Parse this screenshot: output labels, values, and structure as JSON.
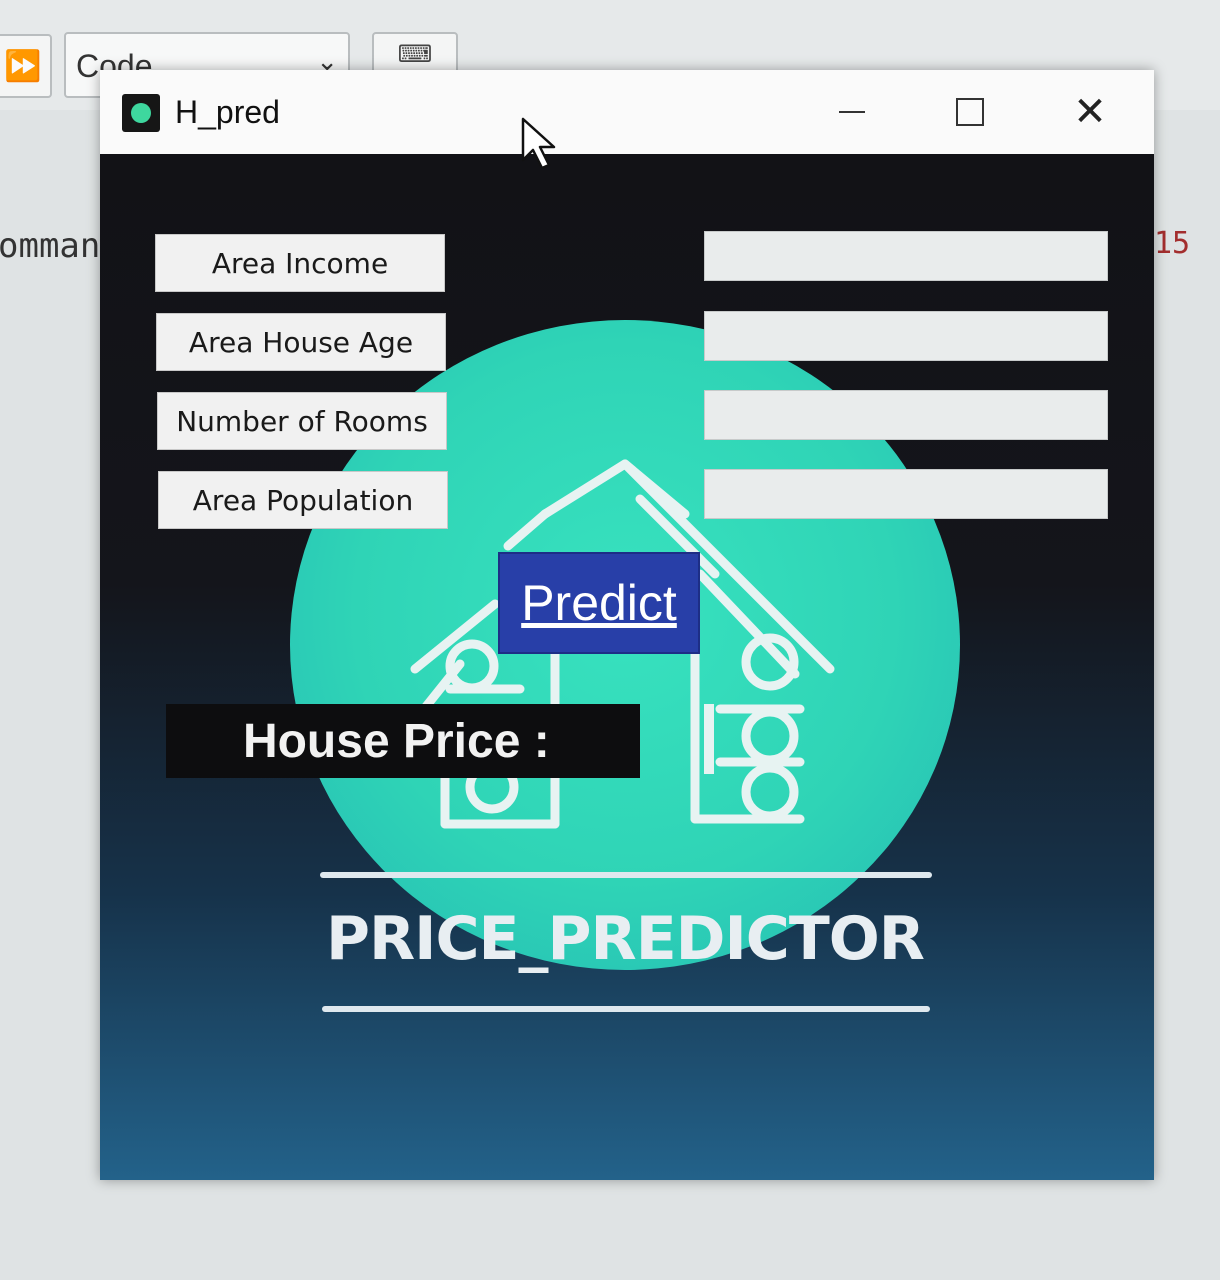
{
  "background": {
    "run_icon": "fast-forward-icon",
    "cell_type_select": "Code",
    "keyboard_icon": "keyboard-icon",
    "left_code_text": "omman",
    "right_code_text": "15"
  },
  "window": {
    "title": "H_pred",
    "app_icon": "app-icon",
    "controls": {
      "minimize": "minimize-icon",
      "maximize": "maximize-icon",
      "close": "close-icon"
    }
  },
  "form": {
    "fields": [
      {
        "label": "Area Income",
        "value": ""
      },
      {
        "label": "Area House Age",
        "value": ""
      },
      {
        "label": "Number of Rooms",
        "value": ""
      },
      {
        "label": "Area Population",
        "value": ""
      }
    ],
    "predict_label": "Predict",
    "result_label": "House Price : "
  },
  "brand": {
    "title": "PRICE_PREDICTOR",
    "logo": "house-logo-icon"
  },
  "colors": {
    "window_bg_top": "#121216",
    "window_bg_bottom": "#23628a",
    "circle": "#2fd4b6",
    "predict_button": "#283fa8",
    "result_bg": "#0d0d0f"
  }
}
